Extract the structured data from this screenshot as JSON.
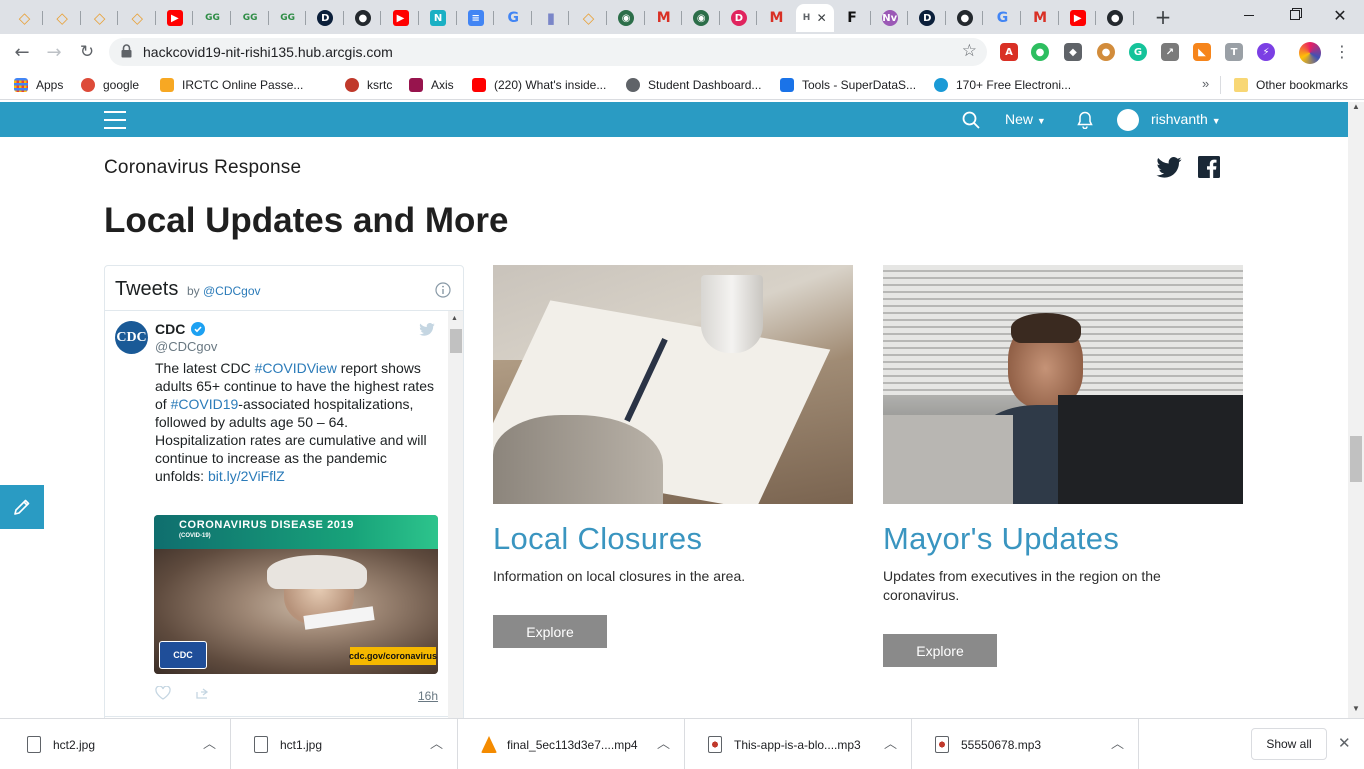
{
  "browser": {
    "tabs": [
      {
        "icon": "blue-diamond-icon",
        "color": "#e8a23a",
        "glyph": "◇"
      },
      {
        "icon": "blue-diamond-icon",
        "color": "#e8a23a",
        "glyph": "◇"
      },
      {
        "icon": "blue-diamond-icon",
        "color": "#e8a23a",
        "glyph": "◇"
      },
      {
        "icon": "blue-diamond-icon",
        "color": "#e8a23a",
        "glyph": "◇"
      },
      {
        "icon": "youtube-icon",
        "color": "#ff0000",
        "glyph": "▶"
      },
      {
        "icon": "geeksforgeeks-icon",
        "color": "#2f8d46",
        "glyph": "GG"
      },
      {
        "icon": "geeksforgeeks-icon",
        "color": "#2f8d46",
        "glyph": "GG"
      },
      {
        "icon": "geeksforgeeks-icon",
        "color": "#2f8d46",
        "glyph": "GG"
      },
      {
        "icon": "d-logo-icon",
        "color": "#0b1f3a",
        "glyph": "D"
      },
      {
        "icon": "github-icon",
        "color": "#24292e",
        "glyph": "●"
      },
      {
        "icon": "youtube-icon",
        "color": "#ff0000",
        "glyph": "▶"
      },
      {
        "icon": "n-logo-icon",
        "color": "#1ab0c4",
        "glyph": "N"
      },
      {
        "icon": "google-docs-icon",
        "color": "#4285f4",
        "glyph": "≡"
      },
      {
        "icon": "google-icon",
        "color": "#4285f4",
        "glyph": "G"
      },
      {
        "icon": "bookmark-icon",
        "color": "#7a86c8",
        "glyph": "▮"
      },
      {
        "icon": "blue-diamond-icon",
        "color": "#e8a23a",
        "glyph": "◇"
      },
      {
        "icon": "globe-icon",
        "color": "#2c6e49",
        "glyph": "◉"
      },
      {
        "icon": "gmail-icon",
        "color": "#d93025",
        "glyph": "M"
      },
      {
        "icon": "globe-icon",
        "color": "#2c6e49",
        "glyph": "◉"
      },
      {
        "icon": "d-circle-icon",
        "color": "#e0245e",
        "glyph": "D"
      },
      {
        "icon": "gmail-icon",
        "color": "#d93025",
        "glyph": "M"
      },
      {
        "icon": "arcgis-icon",
        "color": "#9aa0a6",
        "glyph": "H"
      },
      {
        "icon": "f-logo-icon",
        "color": "#111111",
        "glyph": "F"
      },
      {
        "icon": "nv-icon",
        "color": "#9b59b6",
        "glyph": "Nv"
      },
      {
        "icon": "d-logo-icon",
        "color": "#0b1f3a",
        "glyph": "D"
      },
      {
        "icon": "github-icon",
        "color": "#24292e",
        "glyph": "●"
      },
      {
        "icon": "google-icon",
        "color": "#4285f4",
        "glyph": "G"
      },
      {
        "icon": "gmail-icon",
        "color": "#d93025",
        "glyph": "M"
      },
      {
        "icon": "youtube-icon",
        "color": "#ff0000",
        "glyph": "▶"
      },
      {
        "icon": "github-icon",
        "color": "#24292e",
        "glyph": "●"
      }
    ],
    "active_tab_index": 21,
    "active_tab_title": "H",
    "new_tab_glyph": "+",
    "url": "hackcovid19-nit-rishi135.hub.arcgis.com",
    "bookmarks": [
      {
        "label": "Apps",
        "icon": "apps-grid-icon",
        "color": "#4285f4"
      },
      {
        "label": "google",
        "icon": "google-plus-icon",
        "color": "#dd4b39"
      },
      {
        "label": "IRCTC Online Passe...",
        "icon": "irctc-icon",
        "color": "#f7a823"
      },
      {
        "label": "ksrtc",
        "icon": "ksrtc-icon",
        "color": "#c0392b"
      },
      {
        "label": "Axis",
        "icon": "axis-bank-icon",
        "color": "#97144d"
      },
      {
        "label": "(220) What's inside...",
        "icon": "youtube-icon",
        "color": "#ff0000"
      },
      {
        "label": "Student Dashboard...",
        "icon": "globe-icon",
        "color": "#5f6368"
      },
      {
        "label": "Tools - SuperDataS...",
        "icon": "s-logo-icon",
        "color": "#1a73e8"
      },
      {
        "label": "170+ Free Electroni...",
        "icon": "e-logo-icon",
        "color": "#1a9ad6"
      }
    ],
    "bookmarks_overflow": "»",
    "other_bookmarks": "Other bookmarks"
  },
  "site": {
    "header": {
      "new_label": "New",
      "user_name": "rishvanth"
    },
    "site_title": "Coronavirus Response",
    "page_heading": "Local Updates and More",
    "twitter": {
      "heading": "Tweets",
      "by": "by",
      "handle_link": "@CDCgov",
      "author_name": "CDC",
      "author_handle": "@CDCgov",
      "avatar_text": "CDC",
      "text_1": "The latest CDC ",
      "hashtag_1": "#COVIDView",
      "text_2": " report shows adults 65+ continue to have the highest rates of ",
      "hashtag_2": "#COVID19",
      "text_3": "-associated hospitalizations, followed by adults age 50 – 64. Hospitalization rates are cumulative and will continue to increase as the pandemic unfolds: ",
      "link": "bit.ly/2ViFflZ",
      "image_banner": "CORONAVIRUS DISEASE 2019",
      "image_sub": "(COVID-19)",
      "image_logo": "CDC",
      "image_url_badge": "cdc.gov/coronavirus",
      "time": "16h"
    },
    "cards": [
      {
        "title": "Local Closures",
        "desc": "Information on local closures in the area.",
        "button": "Explore"
      },
      {
        "title": "Mayor's Updates",
        "desc": "Updates from executives in the region on the coronavirus.",
        "button": "Explore"
      }
    ],
    "colors": {
      "brand": "#2a9bc3",
      "link": "#3a95c0",
      "button": "#8a8a8a"
    }
  },
  "downloads": {
    "items": [
      {
        "name": "hct2.jpg",
        "icon": "image-file-icon"
      },
      {
        "name": "hct1.jpg",
        "icon": "image-file-icon"
      },
      {
        "name": "final_5ec113d3e7....mp4",
        "icon": "vlc-file-icon"
      },
      {
        "name": "This-app-is-a-blo....mp3",
        "icon": "audio-file-icon"
      },
      {
        "name": "55550678.mp3",
        "icon": "audio-file-icon"
      }
    ],
    "show_all": "Show all"
  }
}
